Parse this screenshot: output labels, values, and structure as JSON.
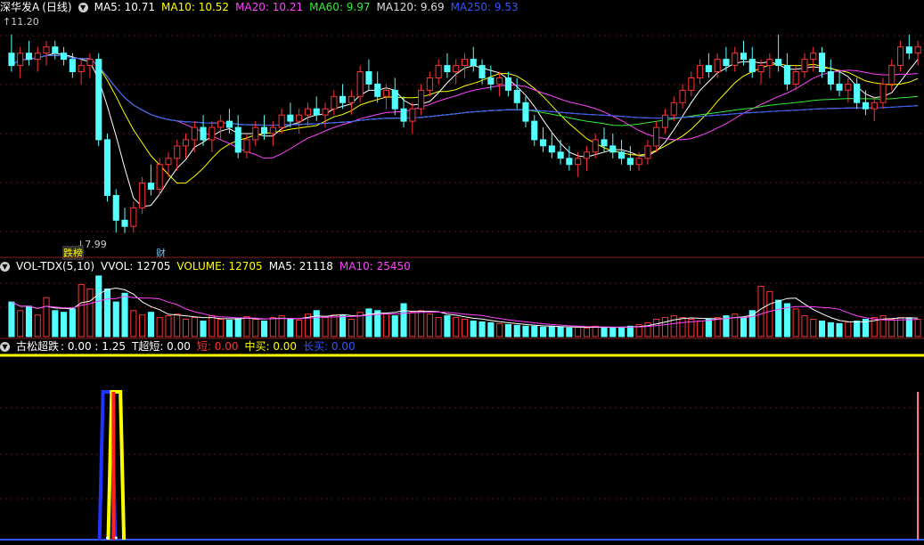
{
  "main": {
    "stock_name": "深华发A",
    "period": "(日线)",
    "ma_labels": [
      {
        "text": "MA5: 10.71",
        "color": "#ffffff"
      },
      {
        "text": "MA10: 10.52",
        "color": "#ffff00"
      },
      {
        "text": "MA20: 10.21",
        "color": "#ff44ff"
      },
      {
        "text": "MA60: 9.97",
        "color": "#33ee33"
      },
      {
        "text": "MA120: 9.69",
        "color": "#dddddd"
      },
      {
        "text": "MA250: 9.53",
        "color": "#3355ff"
      }
    ],
    "high_label": "11.20",
    "low_label": "7.99",
    "marker_left": "跌榜",
    "marker_right": "财"
  },
  "volume": {
    "title": "VOL-TDX(5,10)",
    "labels": [
      {
        "text": "VVOL: 12705",
        "color": "#ffffff"
      },
      {
        "text": "VOLUME: 12705",
        "color": "#ffff00"
      },
      {
        "text": "MA5: 21118",
        "color": "#ffffff"
      },
      {
        "text": "MA10: 25450",
        "color": "#ff44ff"
      }
    ]
  },
  "indicator": {
    "title": "古松超跌",
    "labels": [
      {
        "text": ": 0.00 : 1.25",
        "color": "#ffffff"
      },
      {
        "text": "T超短: 0.00",
        "color": "#ffffff"
      },
      {
        "text": "短: 0.00",
        "color": "#ff3333"
      },
      {
        "text": "中买: 0.00",
        "color": "#ffff00"
      },
      {
        "text": "长买: 0.00",
        "color": "#3355ff"
      }
    ]
  },
  "chart_data": {
    "type": "candlestick",
    "price_range": [
      7.99,
      11.2
    ],
    "candles_ohlc": [
      [
        10.9,
        11.2,
        10.6,
        10.7
      ],
      [
        10.7,
        11.0,
        10.5,
        10.9
      ],
      [
        10.9,
        11.1,
        10.7,
        10.8
      ],
      [
        10.8,
        11.0,
        10.6,
        10.9
      ],
      [
        10.9,
        11.1,
        10.7,
        11.0
      ],
      [
        11.0,
        11.1,
        10.8,
        10.9
      ],
      [
        10.9,
        11.0,
        10.7,
        10.8
      ],
      [
        10.8,
        10.9,
        10.5,
        10.6
      ],
      [
        10.6,
        10.8,
        10.4,
        10.7
      ],
      [
        10.7,
        10.9,
        10.5,
        10.8
      ],
      [
        10.8,
        10.9,
        9.4,
        9.5
      ],
      [
        9.5,
        9.6,
        8.5,
        8.6
      ],
      [
        8.6,
        8.7,
        8.0,
        8.2
      ],
      [
        8.2,
        8.4,
        7.99,
        8.1
      ],
      [
        8.1,
        8.5,
        8.0,
        8.4
      ],
      [
        8.4,
        8.9,
        8.3,
        8.8
      ],
      [
        8.8,
        9.1,
        8.6,
        8.7
      ],
      [
        8.7,
        9.2,
        8.6,
        9.1
      ],
      [
        9.1,
        9.3,
        8.9,
        9.2
      ],
      [
        9.2,
        9.5,
        9.0,
        9.4
      ],
      [
        9.4,
        9.6,
        9.2,
        9.5
      ],
      [
        9.5,
        9.8,
        9.3,
        9.7
      ],
      [
        9.7,
        9.9,
        9.4,
        9.5
      ],
      [
        9.5,
        9.8,
        9.3,
        9.7
      ],
      [
        9.7,
        9.9,
        9.5,
        9.8
      ],
      [
        9.8,
        10.0,
        9.6,
        9.7
      ],
      [
        9.7,
        9.9,
        9.2,
        9.3
      ],
      [
        9.3,
        9.6,
        9.2,
        9.5
      ],
      [
        9.5,
        9.8,
        9.4,
        9.7
      ],
      [
        9.7,
        9.9,
        9.5,
        9.6
      ],
      [
        9.6,
        9.8,
        9.4,
        9.7
      ],
      [
        9.7,
        10.0,
        9.6,
        9.9
      ],
      [
        9.9,
        10.1,
        9.7,
        9.8
      ],
      [
        9.8,
        10.0,
        9.6,
        9.9
      ],
      [
        9.9,
        10.1,
        9.7,
        10.0
      ],
      [
        10.0,
        10.2,
        9.8,
        9.9
      ],
      [
        9.9,
        10.1,
        9.7,
        10.0
      ],
      [
        10.0,
        10.3,
        9.9,
        10.2
      ],
      [
        10.2,
        10.4,
        10.0,
        10.1
      ],
      [
        10.1,
        10.3,
        9.9,
        10.2
      ],
      [
        10.2,
        10.7,
        10.1,
        10.6
      ],
      [
        10.6,
        10.8,
        10.3,
        10.4
      ],
      [
        10.4,
        10.6,
        10.1,
        10.2
      ],
      [
        10.2,
        10.4,
        10.0,
        10.3
      ],
      [
        10.3,
        10.5,
        9.9,
        10.0
      ],
      [
        10.0,
        10.2,
        9.7,
        9.8
      ],
      [
        9.8,
        10.1,
        9.6,
        10.0
      ],
      [
        10.0,
        10.4,
        9.9,
        10.3
      ],
      [
        10.3,
        10.6,
        10.2,
        10.5
      ],
      [
        10.5,
        10.8,
        10.4,
        10.7
      ],
      [
        10.7,
        10.9,
        10.5,
        10.6
      ],
      [
        10.6,
        10.8,
        10.4,
        10.7
      ],
      [
        10.7,
        10.9,
        10.5,
        10.8
      ],
      [
        10.8,
        11.0,
        10.6,
        10.7
      ],
      [
        10.7,
        10.8,
        10.4,
        10.5
      ],
      [
        10.5,
        10.7,
        10.3,
        10.4
      ],
      [
        10.4,
        10.6,
        10.2,
        10.5
      ],
      [
        10.5,
        10.6,
        10.2,
        10.3
      ],
      [
        10.3,
        10.5,
        10.0,
        10.1
      ],
      [
        10.1,
        10.2,
        9.7,
        9.8
      ],
      [
        9.8,
        9.9,
        9.4,
        9.5
      ],
      [
        9.5,
        9.7,
        9.3,
        9.4
      ],
      [
        9.4,
        9.6,
        9.2,
        9.3
      ],
      [
        9.3,
        9.5,
        9.1,
        9.2
      ],
      [
        9.2,
        9.4,
        9.0,
        9.1
      ],
      [
        9.1,
        9.3,
        8.9,
        9.2
      ],
      [
        9.2,
        9.4,
        9.0,
        9.3
      ],
      [
        9.3,
        9.6,
        9.2,
        9.5
      ],
      [
        9.5,
        9.7,
        9.3,
        9.4
      ],
      [
        9.4,
        9.6,
        9.2,
        9.3
      ],
      [
        9.3,
        9.5,
        9.1,
        9.2
      ],
      [
        9.2,
        9.4,
        9.0,
        9.1
      ],
      [
        9.1,
        9.3,
        9.0,
        9.2
      ],
      [
        9.2,
        9.5,
        9.1,
        9.4
      ],
      [
        9.4,
        9.8,
        9.3,
        9.7
      ],
      [
        9.7,
        10.0,
        9.6,
        9.9
      ],
      [
        9.9,
        10.2,
        9.8,
        10.1
      ],
      [
        10.1,
        10.4,
        10.0,
        10.3
      ],
      [
        10.3,
        10.6,
        10.2,
        10.5
      ],
      [
        10.5,
        10.8,
        10.4,
        10.7
      ],
      [
        10.7,
        10.9,
        10.5,
        10.6
      ],
      [
        10.6,
        10.9,
        10.5,
        10.8
      ],
      [
        10.8,
        11.0,
        10.6,
        10.7
      ],
      [
        10.7,
        11.0,
        10.6,
        10.9
      ],
      [
        10.9,
        11.1,
        10.7,
        10.8
      ],
      [
        10.8,
        11.0,
        10.5,
        10.6
      ],
      [
        10.6,
        10.8,
        10.4,
        10.7
      ],
      [
        10.7,
        10.9,
        10.5,
        10.8
      ],
      [
        10.8,
        11.2,
        10.6,
        10.7
      ],
      [
        10.7,
        10.9,
        10.3,
        10.4
      ],
      [
        10.4,
        10.7,
        10.3,
        10.6
      ],
      [
        10.6,
        10.9,
        10.5,
        10.8
      ],
      [
        10.8,
        11.0,
        10.6,
        10.9
      ],
      [
        10.9,
        11.0,
        10.5,
        10.6
      ],
      [
        10.6,
        10.8,
        10.3,
        10.4
      ],
      [
        10.4,
        10.6,
        10.2,
        10.3
      ],
      [
        10.3,
        10.5,
        10.1,
        10.4
      ],
      [
        10.4,
        10.5,
        10.0,
        10.1
      ],
      [
        10.1,
        10.3,
        9.9,
        10.0
      ],
      [
        10.0,
        10.2,
        9.8,
        10.1
      ],
      [
        10.1,
        10.5,
        10.0,
        10.4
      ],
      [
        10.4,
        10.8,
        10.3,
        10.7
      ],
      [
        10.7,
        11.1,
        10.6,
        11.0
      ],
      [
        11.0,
        11.2,
        10.8,
        10.9
      ],
      [
        10.9,
        11.1,
        10.7,
        11.0
      ]
    ],
    "volume_values": [
      40,
      30,
      35,
      25,
      45,
      30,
      28,
      32,
      60,
      55,
      70,
      55,
      40,
      50,
      30,
      25,
      28,
      22,
      24,
      26,
      20,
      22,
      18,
      24,
      20,
      19,
      21,
      23,
      20,
      18,
      22,
      24,
      20,
      19,
      26,
      30,
      22,
      25,
      24,
      20,
      28,
      32,
      30,
      26,
      24,
      38,
      28,
      30,
      26,
      22,
      24,
      22,
      20,
      18,
      17,
      16,
      15,
      14,
      13,
      12,
      12,
      11,
      12,
      11,
      10,
      11,
      10,
      12,
      11,
      10,
      11,
      12,
      14,
      16,
      20,
      22,
      24,
      22,
      20,
      18,
      20,
      22,
      24,
      26,
      22,
      30,
      58,
      52,
      42,
      38,
      32,
      24,
      20,
      18,
      16,
      15,
      17,
      18,
      20,
      22,
      24,
      20,
      22,
      21,
      20
    ],
    "volume_labels": [
      "VVOL: 12705",
      "VOLUME: 12705",
      "MA5: 21118",
      "MA10: 25450"
    ],
    "indicator_series": [
      {
        "name": "T超短",
        "spikes_at": [
          11,
          12
        ]
      },
      {
        "name": "短",
        "spikes_at": [
          12
        ]
      },
      {
        "name": "中买",
        "spikes_at": [
          12
        ]
      },
      {
        "name": "长买",
        "spikes_at": [
          11
        ]
      }
    ],
    "pink_marker_at": 104
  }
}
